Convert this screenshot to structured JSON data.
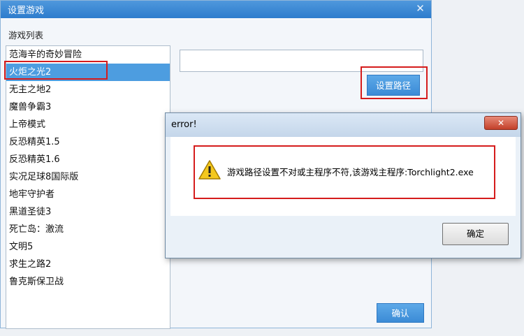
{
  "window": {
    "title": "设置游戏",
    "close_glyph": "✕",
    "list_label": "游戏列表",
    "set_path_label": "设置路径",
    "confirm_label": "确认"
  },
  "games": [
    "范海辛的奇妙冒险",
    "火炬之光2",
    "无主之地2",
    "魔兽争霸3",
    "上帝模式",
    "反恐精英1.5",
    "反恐精英1.6",
    "实况足球8国际版",
    "地牢守护者",
    "黑道圣徒3",
    "死亡岛：激流",
    "文明5",
    "求生之路2",
    "鲁克斯保卫战"
  ],
  "selected_game_index": 1,
  "path_input": {
    "value": ""
  },
  "error_dialog": {
    "title": "error!",
    "close_glyph": "✕",
    "message": "游戏路径设置不对或主程序不符,该游戏主程序:Torchlight2.exe",
    "ok_label": "确定",
    "icon": "warning-icon"
  },
  "colors": {
    "titlebar": "#2d7ccd",
    "selection": "#4d9de0",
    "highlight": "#d51c1c"
  }
}
